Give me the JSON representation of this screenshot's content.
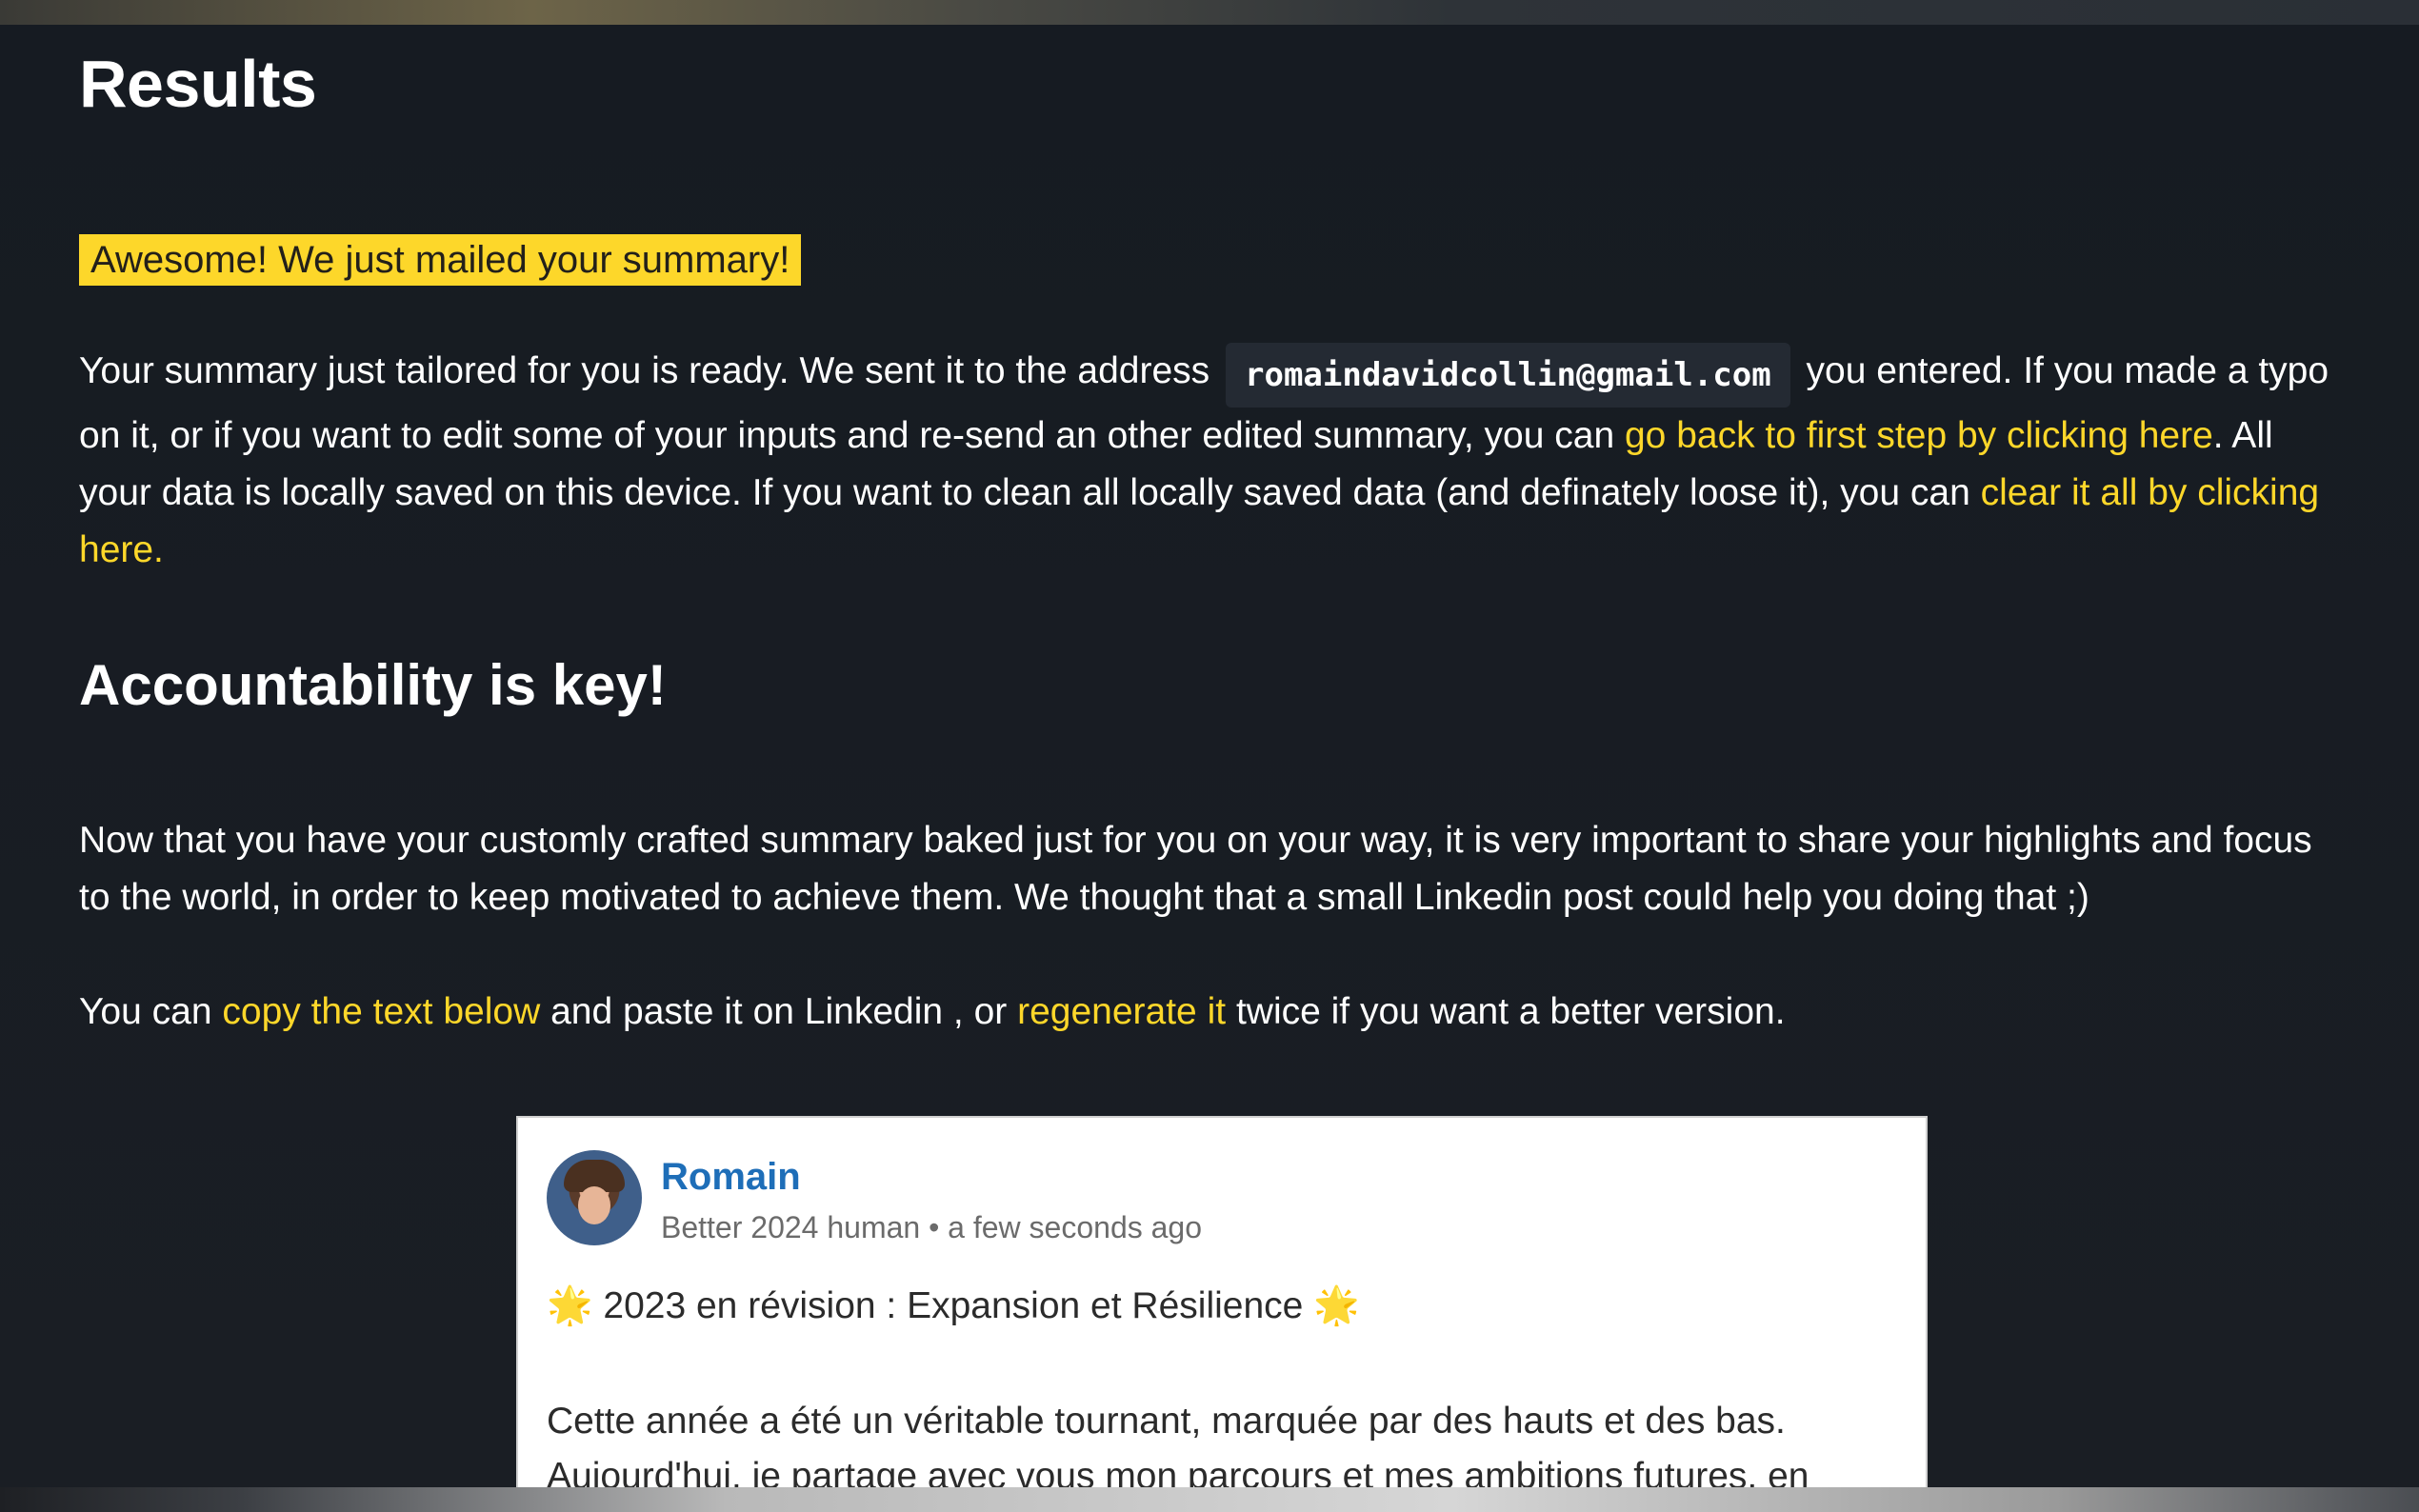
{
  "page": {
    "title": "Results",
    "banner": "Awesome! We just mailed your summary!"
  },
  "intro": {
    "part1": "Your summary just tailored for you is ready. We sent it to the address",
    "email": "romaindavidcollin@gmail.com",
    "part2": "you entered. If you made a typo on it, or if you want to edit some of your inputs and re-send an other edited summary, you can",
    "link_back": "go back to first step by clicking here",
    "part3": ". All your data is locally saved on this device. If you want to clean all locally saved data (and definately loose it), you can",
    "link_clear": "clear it all by clicking here."
  },
  "accountability": {
    "heading": "Accountability is key!",
    "paragraph": "Now that you have your customly crafted summary baked just for you on your way, it is very important to share your highlights and focus to the world, in order to keep motivated to achieve them. We thought that a small Linkedin post could help you doing that ;)",
    "cta_part1": "You can",
    "link_copy": "copy the text below",
    "cta_part2": "and paste it on Linkedin , or",
    "link_regenerate": "regenerate it",
    "cta_part3": "twice if you want a better version."
  },
  "post": {
    "author": "Romain",
    "meta": "Better 2024 human • a few seconds ago",
    "title": "🌟 2023 en révision : Expansion et Résilience 🌟",
    "body": "Cette année a été un véritable tournant, marquée par des hauts et des bas. Aujourd'hui, je partage avec vous mon parcours et mes ambitions futures, en"
  },
  "colors": {
    "background": "#161a21",
    "accent": "#fdd72a",
    "author_link": "#1e6eb8"
  },
  "icons": {
    "avatar": "profile-photo"
  }
}
